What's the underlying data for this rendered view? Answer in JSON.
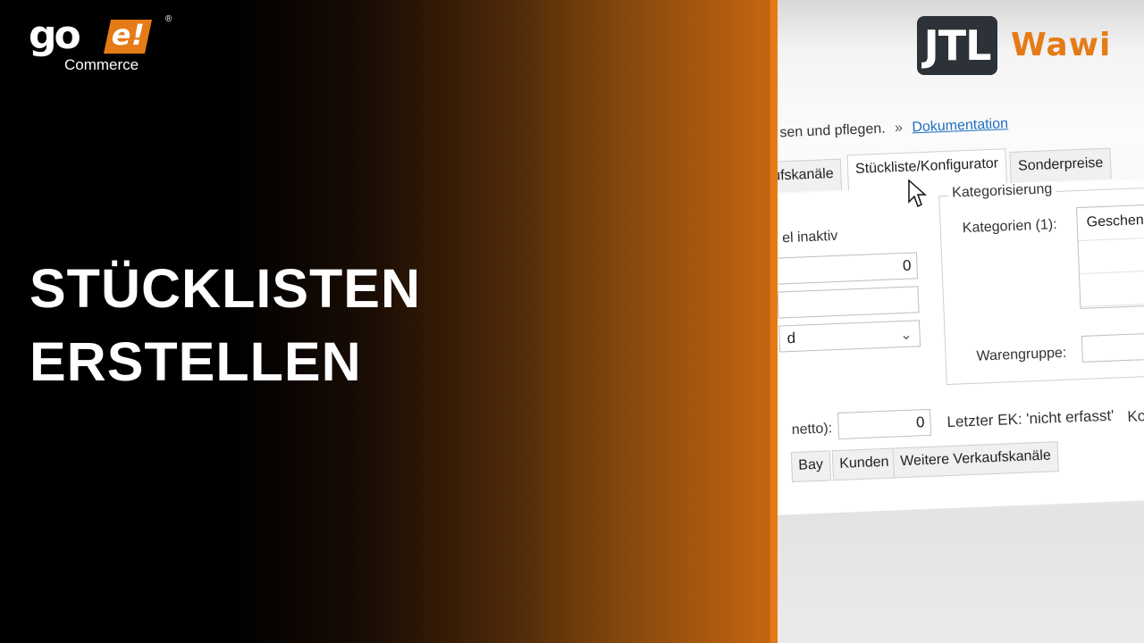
{
  "brand": {
    "logo_go": "go",
    "logo_e": "e!",
    "logo_registered": "®",
    "logo_commerce": "Commerce",
    "accent_color": "#e57b17"
  },
  "headline": {
    "line1": "STÜCKLISTEN",
    "line2": "ERSTELLEN"
  },
  "product_logo": {
    "jtl": "JTL",
    "wawi": "Wawi"
  },
  "app": {
    "description": "sen und pflegen.",
    "separator": "»",
    "doc_link": "Dokumentation",
    "tabs": [
      "Verkaufskanäle",
      "Stückliste/Konfigurator",
      "Sonderpreise"
    ],
    "active_tab": "Stückliste/Konfigurator",
    "left_section": {
      "inactive_label": "el inaktiv",
      "number_value": "0",
      "text_value": "",
      "select_value": "d"
    },
    "categorization": {
      "title": "Kategorisierung",
      "categories_label": "Kategorien (1):",
      "categories": [
        "Geschen"
      ],
      "product_group_label": "Warengruppe:",
      "product_group_value": ""
    },
    "price_row": {
      "label": "netto):",
      "value": "0",
      "last_purchase": "Letzter EK: 'nicht erfasst'",
      "cost_label": "Kost"
    },
    "bottom_tabs": [
      "Bay",
      "Kunden",
      "Weitere Verkaufskanäle"
    ]
  }
}
